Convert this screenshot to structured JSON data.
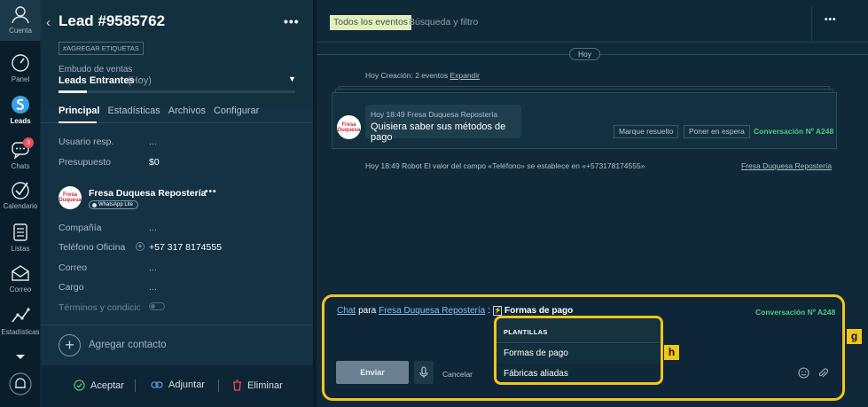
{
  "rail": {
    "items": [
      {
        "label": "Cuenta"
      },
      {
        "label": "Panel"
      },
      {
        "label": "Leads"
      },
      {
        "label": "Chats",
        "badge": "3"
      },
      {
        "label": "Calendario"
      },
      {
        "label": "Listas"
      },
      {
        "label": "Correo"
      },
      {
        "label": "Estadísticas"
      }
    ]
  },
  "lead": {
    "title": "Lead #9585762",
    "more": "•••",
    "tag_button": "#AGREGAR ETIQUETAS",
    "funnel_label": "Embudo de ventas",
    "funnel_value": "Leads Entrantes",
    "funnel_when": "(Hoy)",
    "funnel_progress": 0.12,
    "tabs": [
      "Principal",
      "Estadísticas",
      "Archivos",
      "Configurar"
    ],
    "fields": [
      {
        "label": "Usuario resp.",
        "value": "..."
      },
      {
        "label": "Presupuesto",
        "value": "$0"
      }
    ],
    "contact": {
      "logo_text": "Fresa Duquesa",
      "name": "Fresa Duquesa Repostería",
      "more": "•••",
      "channel": "WhatsApp Lite"
    },
    "contact_fields": [
      {
        "label": "Compañía",
        "value": "..."
      },
      {
        "label": "Teléfono Oficina",
        "value": "+57 317 8174555"
      },
      {
        "label": "Correo",
        "value": "..."
      },
      {
        "label": "Cargo",
        "value": "..."
      },
      {
        "label": "Términos y condicion",
        "value": ""
      }
    ],
    "add_contact": "Agregar contacto",
    "footer": {
      "accept": "Aceptar",
      "attach": "Adjuntar",
      "delete": "Eliminar"
    }
  },
  "chat": {
    "filter_chip": "Todos los eventos",
    "filter_placeholder": "Búsqueda y filtro",
    "more": "•••",
    "day_pill": "Hoy",
    "events_summary": "Hoy Creación: 2 eventos",
    "events_expand": "Expandir",
    "message": {
      "meta": "Hoy 18:49 Fresa Duquesa Repostería",
      "text": "Quisiera saber sus métodos de pago",
      "btn_resolved": "Marque resuelto",
      "btn_hold": "Poner en espera",
      "conversation": "Conversación Nº A248"
    },
    "robot_line": "Hoy 18:49 Robot El valor del campo «Teléfono» se establece en «+573178174555»",
    "robot_link": "Fresa Duquesa Repostería"
  },
  "composer": {
    "chat_link": "Chat",
    "para": "para",
    "recipient": "Fresa Duquesa Repostería",
    "colon": ":",
    "template_title": "Formas de pago",
    "conversation": "Conversación Nº A248",
    "send": "Enviar",
    "cancel": "Cancelar",
    "templates_header": "PLANTILLAS",
    "templates": [
      "Formas de pago",
      "Fábricas aliadas"
    ]
  },
  "callouts": {
    "g": "g",
    "h": "h"
  },
  "colors": {
    "highlight": "#f2c51d",
    "accent_green": "#54c783",
    "link": "#8bb8e8",
    "chip": "#e4edc0"
  }
}
